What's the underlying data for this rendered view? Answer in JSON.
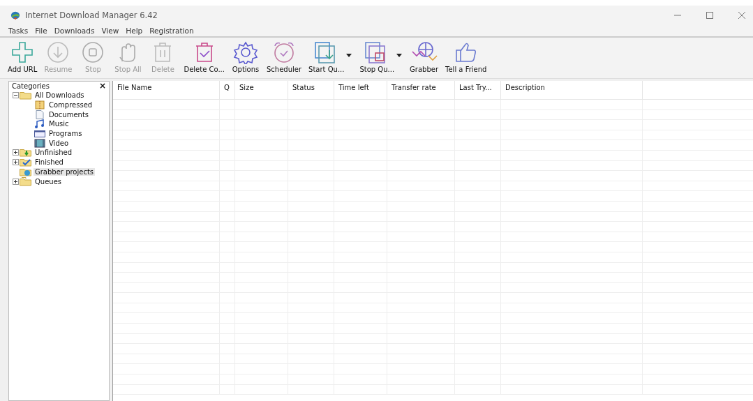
{
  "window": {
    "title": "Internet Download Manager 6.42"
  },
  "menu": [
    "Tasks",
    "File",
    "Downloads",
    "View",
    "Help",
    "Registration"
  ],
  "toolbar": [
    {
      "kind": "add",
      "label": "Add URL",
      "disabled": false,
      "dropdown": false
    },
    {
      "kind": "resume",
      "label": "Resume",
      "disabled": true,
      "dropdown": false
    },
    {
      "kind": "stop",
      "label": "Stop",
      "disabled": true,
      "dropdown": false
    },
    {
      "kind": "stopall",
      "label": "Stop All",
      "disabled": true,
      "dropdown": false
    },
    {
      "kind": "delete",
      "label": "Delete",
      "disabled": true,
      "dropdown": false
    },
    {
      "kind": "deletecompleted",
      "label": "Delete Co...",
      "disabled": false,
      "dropdown": false
    },
    {
      "kind": "options",
      "label": "Options",
      "disabled": false,
      "dropdown": false
    },
    {
      "kind": "scheduler",
      "label": "Scheduler",
      "disabled": false,
      "dropdown": false
    },
    {
      "kind": "startqueue",
      "label": "Start Qu...",
      "disabled": false,
      "dropdown": true
    },
    {
      "kind": "stopqueue",
      "label": "Stop Qu...",
      "disabled": false,
      "dropdown": true
    },
    {
      "kind": "grabber",
      "label": "Grabber",
      "disabled": false,
      "dropdown": false
    },
    {
      "kind": "friend",
      "label": "Tell a Friend",
      "disabled": false,
      "dropdown": false
    }
  ],
  "sidebar": {
    "title": "Categories",
    "close": "×",
    "tree": [
      {
        "kind": "folder",
        "label": "All Downloads",
        "expanded": true,
        "selected": false,
        "children": [
          {
            "kind": "compressed",
            "label": "Compressed",
            "selected": false
          },
          {
            "kind": "document",
            "label": "Documents",
            "selected": false
          },
          {
            "kind": "music",
            "label": "Music",
            "selected": false
          },
          {
            "kind": "program",
            "label": "Programs",
            "selected": false
          },
          {
            "kind": "video",
            "label": "Video",
            "selected": false
          }
        ]
      },
      {
        "kind": "unfinished",
        "label": "Unfinished",
        "expanded": false,
        "selected": false
      },
      {
        "kind": "finished",
        "label": "Finished",
        "expanded": false,
        "selected": false
      },
      {
        "kind": "grabber",
        "label": "Grabber projects",
        "selected": true
      },
      {
        "kind": "queues",
        "label": "Queues",
        "expanded": false,
        "selected": false
      }
    ]
  },
  "table": {
    "columns": [
      "File Name",
      "Q",
      "Size",
      "Status",
      "Time left",
      "Transfer rate",
      "Last Try...",
      "Description"
    ]
  }
}
